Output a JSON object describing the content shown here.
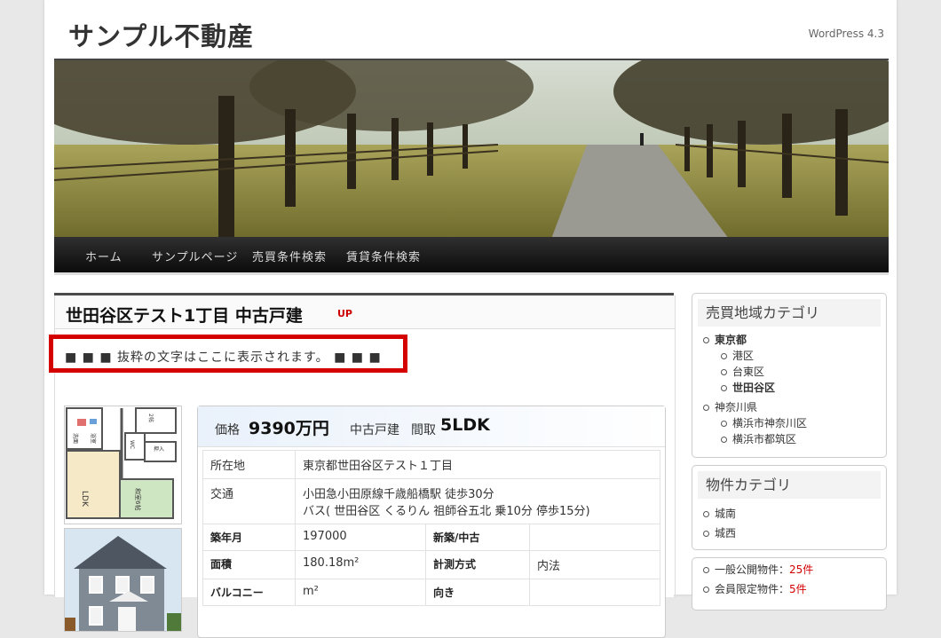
{
  "site": {
    "title": "サンプル不動産",
    "description": "WordPress 4.3"
  },
  "nav": {
    "items": [
      "ホーム",
      "サンプルページ",
      "売買条件検索",
      "賃貸条件検索"
    ]
  },
  "post": {
    "title": "世田谷区テスト1丁目 中古戸建",
    "badge": "UP",
    "excerpt": "■ ■ ■ 抜粋の文字はここに表示されます。 ■ ■ ■",
    "price_label": "価格",
    "price_value": "9390万円",
    "type_value": "中古戸建",
    "layout_label": "間取",
    "layout_value": "5LDK",
    "floor_plan_labels": [
      "LDK",
      "和室6帖",
      "洗面",
      "浴室",
      "WC",
      "押入",
      "2帖"
    ],
    "specs": [
      {
        "key": "所在地",
        "value": "東京都世田谷区テスト１丁目"
      },
      {
        "key": "交通",
        "value_lines": [
          "小田急小田原線千歳船橋駅 徒歩30分",
          "バス( 世田谷区 くるりん 祖師谷五北 乗10分 停歩15分)"
        ]
      },
      {
        "k1": "築年月",
        "v1": "197000",
        "k2": "新築/中古",
        "v2": ""
      },
      {
        "k1": "面積",
        "v1": "180.18m²",
        "k2": "計測方式",
        "v2": "内法"
      },
      {
        "k1": "バルコニー",
        "v1": "m²",
        "k2": "向き",
        "v2": ""
      }
    ]
  },
  "sidebar": {
    "area_widget": {
      "title": "売買地域カテゴリ",
      "items": [
        {
          "label": "東京都",
          "bold": true,
          "children": [
            "港区",
            "台東区",
            "世田谷区"
          ]
        },
        {
          "label": "神奈川県",
          "bold": false,
          "children": [
            "横浜市神奈川区",
            "横浜市都筑区"
          ]
        }
      ]
    },
    "property_widget": {
      "title": "物件カテゴリ",
      "items": [
        "城南",
        "城西"
      ]
    },
    "count_widget": {
      "items": [
        {
          "label": "一般公開物件：",
          "count": "25件"
        },
        {
          "label": "会員限定物件：",
          "count": "5件"
        }
      ]
    }
  },
  "colors": {
    "accent_red": "#d40000",
    "nav_bg": "#1a1a1a"
  }
}
